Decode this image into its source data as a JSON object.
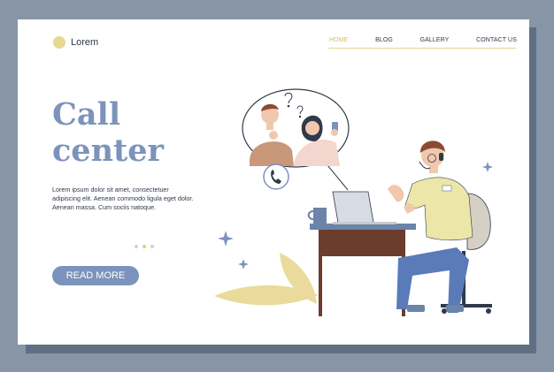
{
  "logo": {
    "text": "Lorem"
  },
  "nav": {
    "items": [
      {
        "label": "HOME",
        "active": true
      },
      {
        "label": "BLOG",
        "active": false
      },
      {
        "label": "GALLERY",
        "active": false
      },
      {
        "label": "CONTACT US",
        "active": false
      }
    ]
  },
  "hero": {
    "title_line1": "Call",
    "title_line2": "center",
    "description_line1": "Lorem ipsum dolor sit amet, consectetuer",
    "description_line2": "adipiscing elit. Aenean commodo ligula eget dolor.",
    "description_line3": "Aenean massa. Cum sociis natoque.",
    "read_more_label": "READ MORE",
    "carousel": {
      "count": 3,
      "active_index": 1
    }
  },
  "colors": {
    "page_background": "#8795a6",
    "card_background": "#ffffff",
    "accent_blue": "#7c93bb",
    "accent_yellow": "#e8d78f",
    "text_dark": "#2f3a4a"
  },
  "illustration": {
    "icons": [
      "phone-icon",
      "question-mark-icon",
      "sparkle-icon",
      "laptop-icon",
      "headset-icon",
      "mug-icon"
    ]
  }
}
